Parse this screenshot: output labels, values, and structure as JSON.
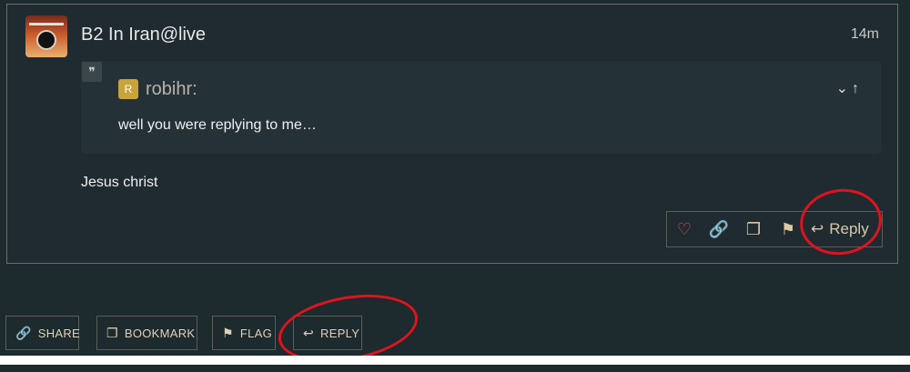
{
  "post": {
    "author": "B2 In Iran@live",
    "time": "14m",
    "quote": {
      "avatar_letter": "R",
      "user": "robihr:",
      "text": "well you were replying to me…"
    },
    "body": "Jesus christ",
    "actions": {
      "reply_label": "Reply"
    }
  },
  "footer": {
    "share_label": "SHARE",
    "bookmark_label": "BOOKMARK",
    "flag_label": "FLAG",
    "reply_label": "REPLY"
  },
  "annotations": {
    "circle_color": "#e0131e"
  },
  "icons": [
    "heart-icon",
    "link-icon",
    "bookmark-icon",
    "flag-icon",
    "reply-icon",
    "chevron-down-icon",
    "arrow-up-icon",
    "quote-icon"
  ]
}
